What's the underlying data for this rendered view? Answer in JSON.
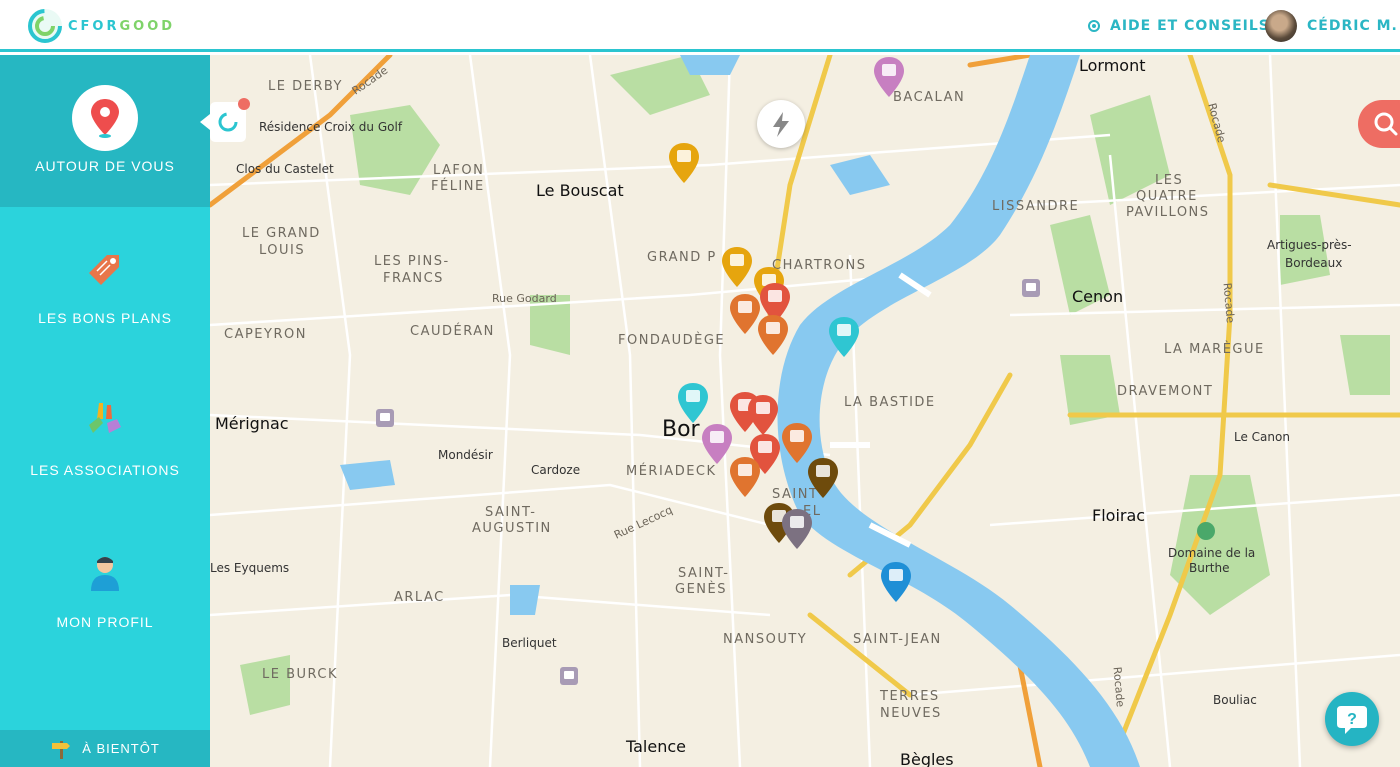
{
  "header": {
    "logo_text_1": "CFOR",
    "logo_text_2": "GOOD",
    "help_label": "AIDE ET CONSEILS",
    "user_name": "CÉDRIC M."
  },
  "sidebar": {
    "items": [
      {
        "label": "AUTOUR DE VOUS",
        "icon": "location-pin-icon",
        "active": true
      },
      {
        "label": "LES BONS PLANS",
        "icon": "price-tag-icon",
        "active": false
      },
      {
        "label": "LES ASSOCIATIONS",
        "icon": "hands-icon",
        "active": false
      },
      {
        "label": "MON PROFIL",
        "icon": "user-icon",
        "active": false
      }
    ],
    "footer_label": "À BIENTÔT",
    "footer_icon": "signpost-icon"
  },
  "map": {
    "labels": {
      "le_derby": "LE DERBY",
      "residence": "Résidence Croix du Golf",
      "clos": "Clos du Castelet",
      "lafon": "LAFON",
      "feline": "FÉLINE",
      "bouscat": "Le Bouscat",
      "grand_louis_1": "LE GRAND",
      "grand_louis_2": "LOUIS",
      "pins_1": "LES PINS-",
      "pins_2": "FRANCS",
      "rue_godard": "Rue Godard",
      "grand_parc": "GRAND P",
      "chartrons": "CHARTRONS",
      "capeyron": "CAPEYRON",
      "cauderan": "CAUDÉRAN",
      "fondaudege": "FONDAUDÈGE",
      "merignac": "Mérignac",
      "bordeaux": "Bor",
      "mondesir": "Mondésir",
      "cardoze": "Cardoze",
      "meriadeck": "MÉRIADECK",
      "saint_augustin_1": "SAINT-",
      "saint_augustin_2": "AUGUSTIN",
      "rue_lecocq": "Rue Lecocq",
      "saint_michel_1": "SAINT",
      "saint_michel_2": "EL",
      "la_bastide": "LA BASTIDE",
      "les_eyquems": "Les Eyquems",
      "arlac": "ARLAC",
      "saint_genes_1": "SAINT-",
      "saint_genes_2": "GENÈS",
      "berliquet": "Berliquet",
      "nansouty": "NANSOUTY",
      "saint_jean": "SAINT-JEAN",
      "le_burck": "LE BURCK",
      "terres_1": "TERRES",
      "terres_2": "NEUVES",
      "talence": "Talence",
      "begles": "Bègles",
      "lormont": "Lormont",
      "bacalan": "BACALAN",
      "lissandre": "LISSANDRE",
      "quatre_1": "LES",
      "quatre_2": "QUATRE",
      "quatre_3": "PAVILLONS",
      "artigues_1": "Artigues-près-",
      "artigues_2": "Bordeaux",
      "cenon": "Cenon",
      "mareque": "LA MARÈGUE",
      "dravemont": "DRAVEMONT",
      "le_canon": "Le Canon",
      "floirac": "Floirac",
      "domaine_1": "Domaine de la",
      "domaine_2": "Burthe",
      "bouliac": "Bouliac",
      "rocade_1": "Rocade",
      "rocade_2": "Rocade",
      "rocade_3": "Rocade",
      "rocade_4": "Rocade"
    },
    "markers": [
      {
        "name": "marker-shop-1",
        "color": "#e6a50e"
      },
      {
        "name": "marker-shop-2",
        "color": "#e6a50e"
      },
      {
        "name": "marker-shop-3",
        "color": "#e6a50e"
      },
      {
        "name": "marker-gift-1",
        "color": "#e2533e"
      },
      {
        "name": "marker-gift-2",
        "color": "#e2533e"
      },
      {
        "name": "marker-gift-3",
        "color": "#e2533e"
      },
      {
        "name": "marker-gift-4",
        "color": "#e2533e"
      },
      {
        "name": "marker-orange-1",
        "color": "#e0742f"
      },
      {
        "name": "marker-orange-2",
        "color": "#e0742f"
      },
      {
        "name": "marker-orange-3",
        "color": "#e0742f"
      },
      {
        "name": "marker-restaurant",
        "color": "#e0742f"
      },
      {
        "name": "marker-association-1",
        "color": "#2fc6d2"
      },
      {
        "name": "marker-association-2",
        "color": "#2fc6d2"
      },
      {
        "name": "marker-health-1",
        "color": "#c77fc1"
      },
      {
        "name": "marker-health-2",
        "color": "#c77fc1"
      },
      {
        "name": "marker-cafe-1",
        "color": "#6e4b0c"
      },
      {
        "name": "marker-cafe-2",
        "color": "#6e4b0c"
      },
      {
        "name": "marker-hair",
        "color": "#7c7181"
      },
      {
        "name": "marker-theatre",
        "color": "#1f8fd6"
      }
    ],
    "colors": {
      "river": "#88c9f0",
      "land": "#f4efe2",
      "park": "#b9dea3",
      "road_major": "#f0c94a",
      "road_orange": "#f0a03a",
      "accent": "#2bc5d0"
    }
  }
}
